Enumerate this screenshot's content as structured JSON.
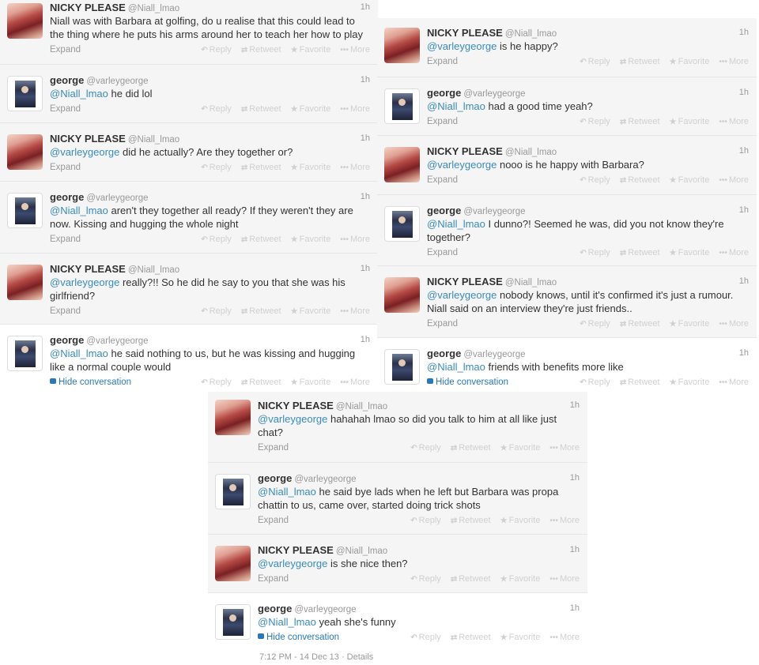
{
  "users": {
    "nicky": {
      "name": "NICKY PLEASE",
      "handle": "@Niall_lmao"
    },
    "george": {
      "name": "george",
      "handle": "@varleygeorge"
    }
  },
  "labels": {
    "expand": "Expand",
    "hide_conversation": "Hide conversation",
    "reply": "Reply",
    "retweet": "Retweet",
    "favorite": "Favorite",
    "more": "More",
    "time": "1h"
  },
  "icons": {
    "reply": "reply-arrow-icon",
    "retweet": "retweet-icon",
    "favorite": "star-icon",
    "more": "more-dots-icon",
    "hide": "speech-bubble-icon"
  },
  "colors": {
    "link": "#3a8bbb",
    "hide_link": "#2a79b7",
    "muted": "#999999"
  },
  "left": [
    {
      "mention": "",
      "text": "Niall was with Barbara at golfing, do u realise that this could lead to the thing where he puts his arms around her to teach her how to play"
    },
    {
      "mention": "@Niall_lmao",
      "text": " he did lol"
    },
    {
      "mention": "@varleygeorge",
      "text": " did he actually? Are they together or?"
    },
    {
      "mention": "@Niall_lmao",
      "text": " aren't they together all ready? If they weren't they are now. Kissing and hugging the whole night"
    },
    {
      "mention": "@varleygeorge",
      "text": " really?!! So he did he say to you that she was his girlfriend?"
    },
    {
      "mention": "@Niall_lmao",
      "text": " he said nothing to us, but he was kissing and hugging like a normal couple would"
    }
  ],
  "right": [
    {
      "mention": "@varleygeorge",
      "text": " is he happy?"
    },
    {
      "mention": "@Niall_lmao",
      "text": " had a good time yeah?"
    },
    {
      "mention": "@varleygeorge",
      "text": " nooo is he happy with Barbara?"
    },
    {
      "mention": "@Niall_lmao",
      "text": " I dunno?! Seemed he was, did you not know they're together?"
    },
    {
      "mention": "@varleygeorge",
      "text": " nobody knows, until it's confirmed it's just a rumour. Niall said on an interview they're just friends.."
    },
    {
      "mention": "@Niall_lmao",
      "text": " friends with benefits more like"
    }
  ],
  "bottom": [
    {
      "mention": "@varleygeorge",
      "text": " hahahah lmao so did you talk to him at all like just chat?"
    },
    {
      "mention": "@Niall_lmao",
      "text": " he said bye lads when he left but Barbara was propa chattin to us, came over, started doing trick shots"
    },
    {
      "mention": "@varleygeorge",
      "text": " is she nice then?"
    },
    {
      "mention": "@Niall_lmao",
      "text": " yeah she's funny"
    }
  ],
  "footer": {
    "timestamp": "7:12 PM - 14 Dec 13 · Details"
  }
}
